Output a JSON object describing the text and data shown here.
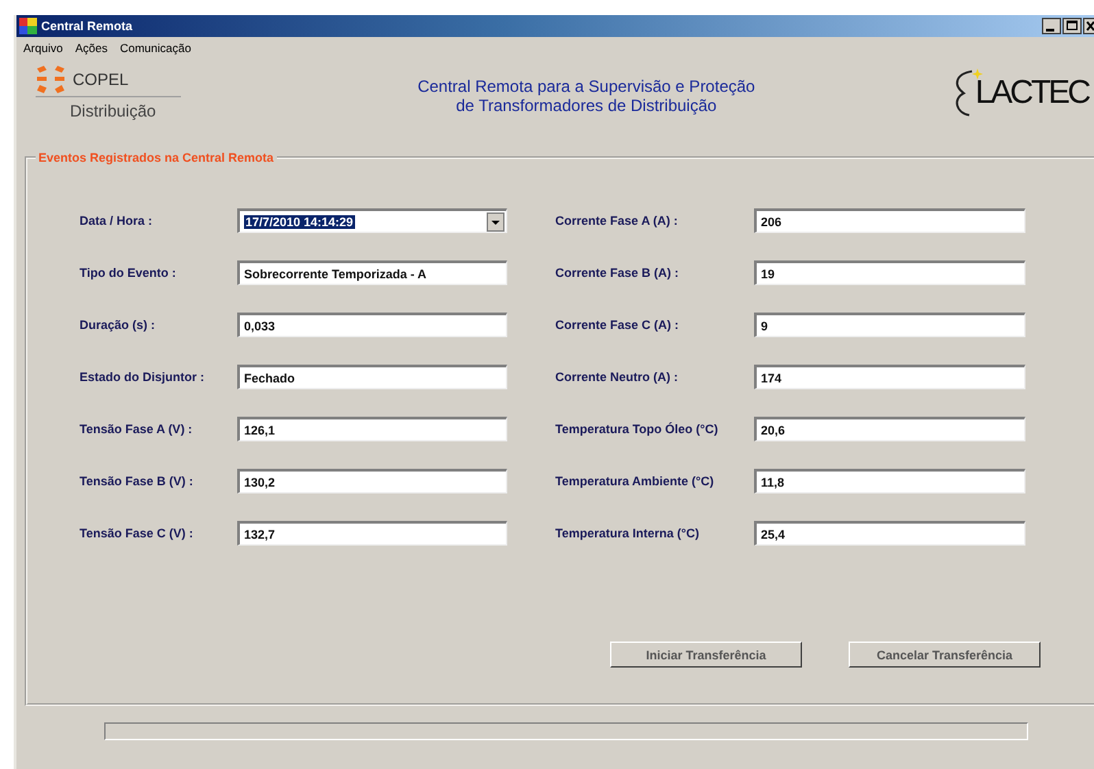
{
  "window": {
    "title": "Central Remota"
  },
  "menu": [
    {
      "label": "Arquivo"
    },
    {
      "label": "Ações"
    },
    {
      "label": "Comunicação"
    }
  ],
  "header": {
    "brand": {
      "name": "COPEL",
      "sub": "Distribuição"
    },
    "title_lines": [
      "Central Remota para a Supervisão e Proteção",
      "de Transformadores de Distribuição"
    ],
    "partner": "LACTEC"
  },
  "group": {
    "title": "Eventos Registrados na Central Remota",
    "left_fields": [
      {
        "label": "Data / Hora :",
        "value": "17/7/2010 14:14:29",
        "kind": "combo"
      },
      {
        "label": "Tipo do Evento :",
        "value": "Sobrecorrente Temporizada - A",
        "kind": "text"
      },
      {
        "label": "Duração (s) :",
        "value": "0,033",
        "kind": "text"
      },
      {
        "label": "Estado do Disjuntor :",
        "value": "Fechado",
        "kind": "text"
      },
      {
        "label": "Tensão Fase A (V) :",
        "value": "126,1",
        "kind": "text"
      },
      {
        "label": "Tensão Fase B (V) :",
        "value": "130,2",
        "kind": "text"
      },
      {
        "label": "Tensão Fase C (V) :",
        "value": "132,7",
        "kind": "text"
      }
    ],
    "right_fields": [
      {
        "label": "Corrente Fase A (A) :",
        "value": "206",
        "kind": "text"
      },
      {
        "label": "Corrente Fase B (A) :",
        "value": "19",
        "kind": "text"
      },
      {
        "label": "Corrente Fase C (A) :",
        "value": "9",
        "kind": "text"
      },
      {
        "label": "Corrente Neutro (A) :",
        "value": "174",
        "kind": "text"
      },
      {
        "label": "Temperatura Topo Óleo (°C)",
        "value": "20,6",
        "kind": "text"
      },
      {
        "label": "Temperatura Ambiente (°C)",
        "value": "11,8",
        "kind": "text"
      },
      {
        "label": "Temperatura Interna (°C)",
        "value": "25,4",
        "kind": "text"
      }
    ]
  },
  "buttons": [
    {
      "label": "Iniciar Transferência"
    },
    {
      "label": "Cancelar Transferência"
    }
  ],
  "progress": {
    "level": 0
  }
}
